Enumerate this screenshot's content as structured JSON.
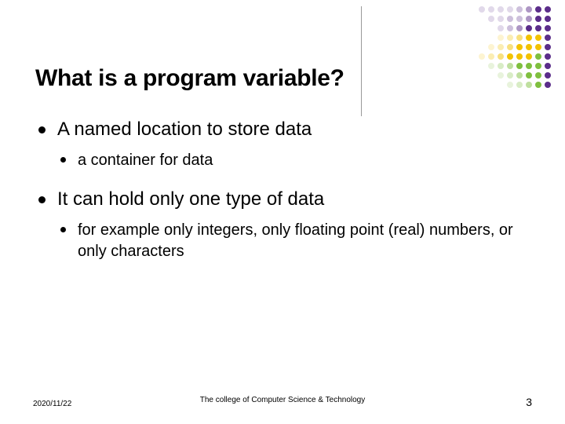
{
  "title": "What is a program variable?",
  "bullets": {
    "b1": "A named location to store data",
    "b1a": "a container for data",
    "b2": "It can hold only one type of data",
    "b2a": "for example only integers, only floating point (real) numbers, or only characters"
  },
  "footer": {
    "date": "2020/11/22",
    "org": "The college of Computer Science & Technology",
    "page": "3"
  }
}
